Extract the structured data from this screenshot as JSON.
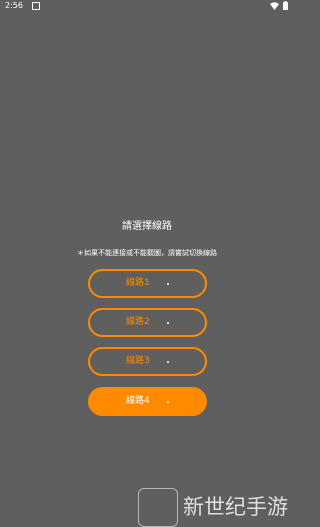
{
  "status_bar": {
    "time": "2:56",
    "app_icon": "notification-app-icon",
    "wifi_icon": "wifi-icon",
    "battery_icon": "battery-icon"
  },
  "dialog": {
    "title": "請選擇線路",
    "notice": "＊如果不能連接或不能觀圖，請嘗試切換線路"
  },
  "routes": [
    {
      "label": "線路1"
    },
    {
      "label": "線路2"
    },
    {
      "label": "線路3"
    },
    {
      "label": "線路4",
      "selected": true
    }
  ],
  "colors": {
    "background": "#5f5f5f",
    "accent": "#ff8a00",
    "text": "#ffffff"
  },
  "watermark": {
    "text": "新世纪手游"
  }
}
